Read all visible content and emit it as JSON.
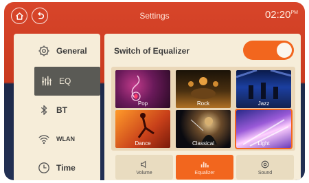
{
  "header": {
    "title": "Settings",
    "time": "02:20",
    "time_suffix": "PM"
  },
  "sidebar": {
    "items": [
      {
        "label": "General",
        "icon": "gear-icon"
      },
      {
        "label": "EQ",
        "icon": "equalizer-icon",
        "active": true
      },
      {
        "label": "BT",
        "icon": "bluetooth-icon"
      },
      {
        "label": "WLAN",
        "icon": "wifi-icon"
      },
      {
        "label": "Time",
        "icon": "clock-icon"
      }
    ]
  },
  "panel": {
    "switch_label": "Switch of Equalizer",
    "switch_on": true,
    "presets": [
      {
        "label": "Pop"
      },
      {
        "label": "Rock"
      },
      {
        "label": "Jazz"
      },
      {
        "label": "Dance"
      },
      {
        "label": "Classical"
      },
      {
        "label": "Light",
        "selected": true
      }
    ],
    "tabs": [
      {
        "label": "Volume",
        "icon": "speaker-icon"
      },
      {
        "label": "Equalizer",
        "icon": "equalizer-icon",
        "active": true
      },
      {
        "label": "Sound",
        "icon": "sound-icon"
      }
    ]
  },
  "colors": {
    "accent": "#f2661e",
    "header": "#d8452a",
    "panel": "#f6edd9"
  }
}
